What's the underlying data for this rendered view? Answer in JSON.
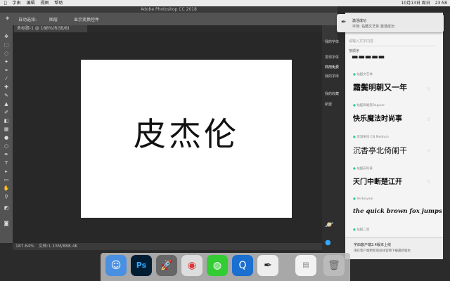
{
  "menubar": {
    "apple": "",
    "items": [
      "字由",
      "编辑",
      "视图",
      "帮助"
    ],
    "right": [
      "10月13日 周日",
      "23:58"
    ]
  },
  "ps": {
    "title": "Adobe Photoshop CC 2018",
    "options": [
      "自动选择:",
      "图层",
      "显示变换控件"
    ],
    "doc_tab": "未标题-1 @ 188%(RGB/8)",
    "doc_text": "皮杰伦",
    "status": [
      "187.64%",
      "文档:1.15M/888.4K"
    ]
  },
  "plugin": {
    "notice_title": "激活成功",
    "notice_sub": "字体: 站酷文艺体 激活成功",
    "search_placeholder": "请输入文字内容",
    "sort": "按顺序",
    "nav": [
      "我的字体",
      "发现字体",
      "商用免费",
      "我的字库",
      "我的收藏",
      "新建"
    ],
    "fonts": [
      {
        "name": "站酷文艺体",
        "sample": "霜鬓明朝又一年"
      },
      {
        "name": "站酷高端黑Regular",
        "sample": "快乐魔法时尚事"
      },
      {
        "name": "思源宋体 CN Medium",
        "sample": "沉香亭北倚阑干"
      },
      {
        "name": "站酷庆科黄",
        "sample": "天门中断楚江开"
      },
      {
        "name": "Yesteryear",
        "sample": "the quick brown fox jumps"
      },
      {
        "name": "站酷二星",
        "sample": ""
      }
    ],
    "update_title": "字由客户端2.4版本上线",
    "update_sub": "请在客户端更新或前往官网下载最新版本"
  },
  "colors": {
    "accent": "#3c9",
    "ps_blue": "#31a8ff"
  }
}
